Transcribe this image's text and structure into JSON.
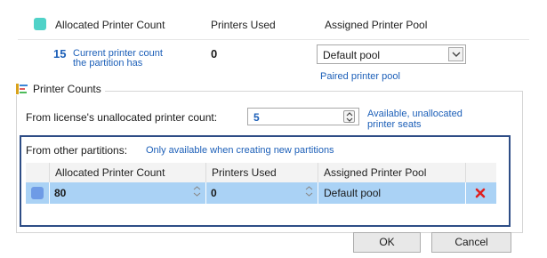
{
  "header": {
    "swatch_color": "#50d2c8",
    "col_allocated": "Allocated Printer Count",
    "col_used": "Printers Used",
    "col_pool": "Assigned Printer Pool"
  },
  "current": {
    "count": "15",
    "count_desc": "Current printer count\nthe partition has",
    "used": "0",
    "pool_value": "Default pool",
    "pool_caption": "Paired printer pool"
  },
  "printer_counts": {
    "group_title": "Printer Counts",
    "license_label": "From license's unallocated printer count:",
    "license_value": "5",
    "license_hint": "Available, unallocated\nprinter seats"
  },
  "other_partitions": {
    "label": "From other partitions:",
    "note": "Only available when creating new partitions",
    "columns": [
      "Allocated Printer Count",
      "Printers Used",
      "Assigned Printer Pool"
    ],
    "rows": [
      {
        "swatch_color": "#6e9be6",
        "allocated": "80",
        "used": "0",
        "pool": "Default pool"
      }
    ]
  },
  "buttons": {
    "ok": "OK",
    "cancel": "Cancel"
  },
  "colors": {
    "accent_blue": "#1c5fb8",
    "row_highlight": "#aad2f5",
    "delete_red": "#e02020"
  }
}
